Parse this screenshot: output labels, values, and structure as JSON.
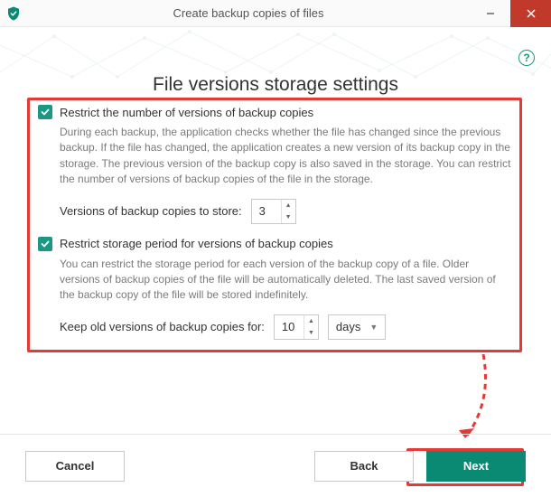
{
  "window": {
    "title": "Create backup copies of files"
  },
  "page": {
    "title": "File versions storage settings"
  },
  "section1": {
    "checked": true,
    "label": "Restrict the number of versions of backup copies",
    "description": "During each backup, the application checks whether the file has changed since the previous backup. If the file has changed, the application creates a new version of its backup copy in the storage. The previous version of the backup copy is also saved in the storage. You can restrict the number of versions of backup copies of the file in the storage.",
    "field_label": "Versions of backup copies to store:",
    "value": "3"
  },
  "section2": {
    "checked": true,
    "label": "Restrict storage period for versions of backup copies",
    "description": "You can restrict the storage period for each version of the backup copy of a file. Older versions of backup copies of the file will be automatically deleted. The last saved version of the backup copy of the file will be stored indefinitely.",
    "field_label": "Keep old versions of backup copies for:",
    "value": "10",
    "unit": "days"
  },
  "footer": {
    "cancel": "Cancel",
    "back": "Back",
    "next": "Next"
  },
  "help": {
    "symbol": "?"
  }
}
